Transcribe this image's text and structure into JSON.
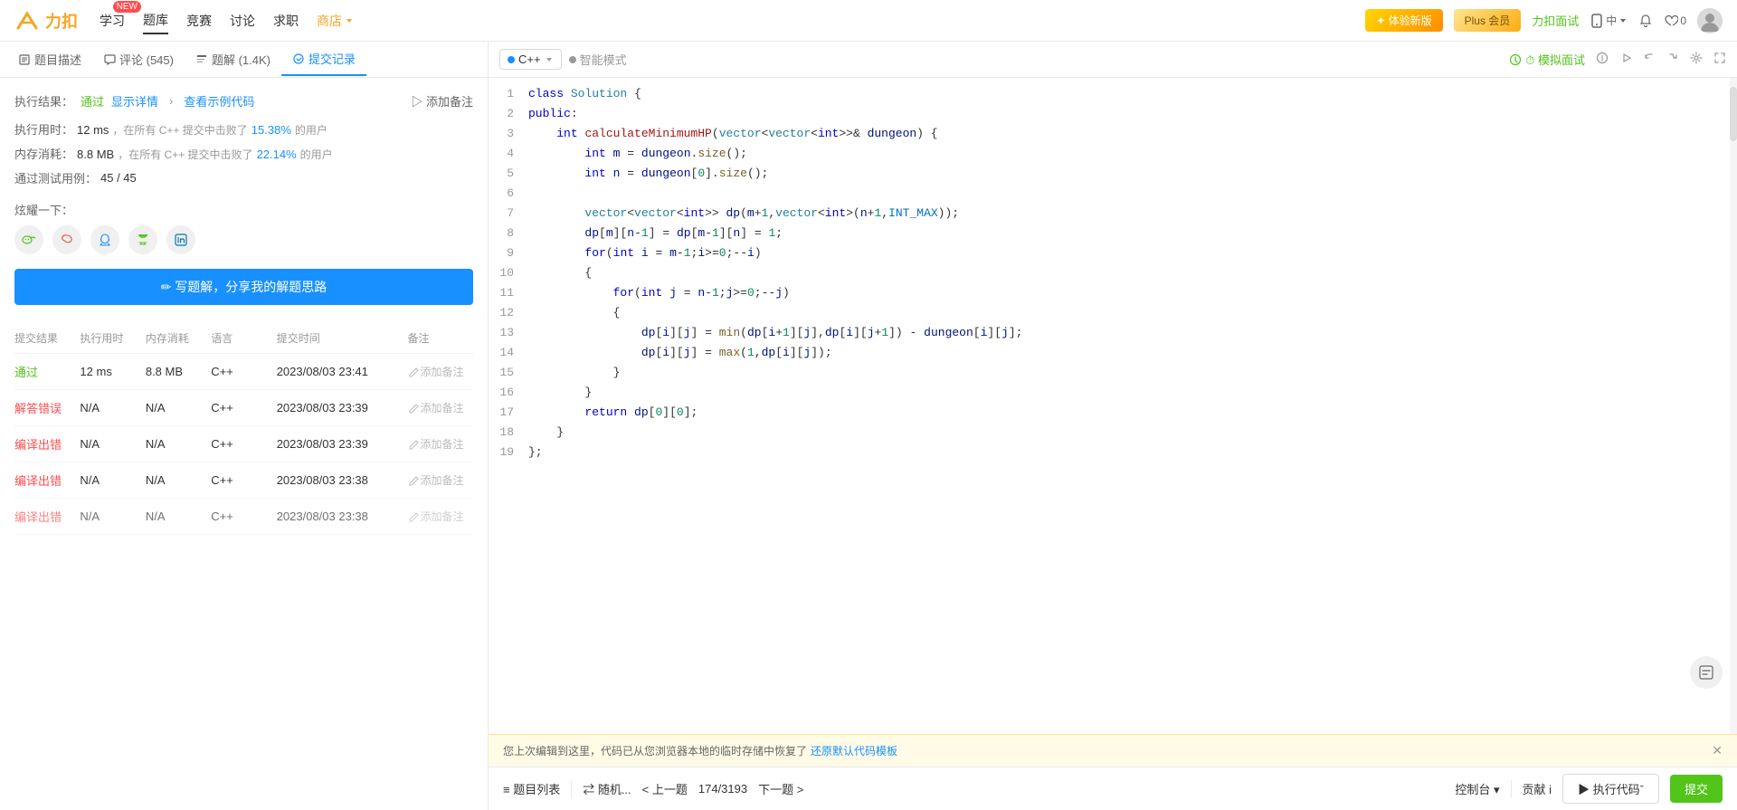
{
  "nav": {
    "logo": "力扣",
    "items": [
      {
        "label": "学习",
        "active": false,
        "badge": "NEW"
      },
      {
        "label": "题库",
        "active": true
      },
      {
        "label": "竞赛",
        "active": false
      },
      {
        "label": "讨论",
        "active": false
      },
      {
        "label": "求职",
        "active": false
      },
      {
        "label": "商店",
        "active": false,
        "shop": true
      }
    ],
    "experience_btn": "✦ 体验新版",
    "plus_btn": "Plus 会员",
    "interview_btn": "力扣面试",
    "phone_icon": "📱",
    "font_size": "中",
    "bell_icon": "🔔",
    "like_count": "0"
  },
  "tabs": [
    {
      "label": "题目描述",
      "icon": "≡"
    },
    {
      "label": "评论 (545)",
      "icon": "💬"
    },
    {
      "label": "题解 (1.4K)",
      "icon": "📄"
    },
    {
      "label": "提交记录",
      "active": true,
      "icon": "📋"
    }
  ],
  "result": {
    "label": "执行结果：",
    "status": "通过",
    "detail_link": "显示详情",
    "example_link": "查看示例代码",
    "add_note": "▷ 添加备注",
    "runtime_label": "执行用时：",
    "runtime_value": "12 ms",
    "runtime_beat_text": "，在所有 C++ 提交中击败了",
    "runtime_percent": "15.38%",
    "runtime_suffix": "的用户",
    "memory_label": "内存消耗：",
    "memory_value": "8.8 MB",
    "memory_beat_text": "，在所有 C++ 提交中击败了",
    "memory_percent": "22.14%",
    "memory_suffix": "的用户",
    "testcase_label": "通过测试用例：",
    "testcase_value": "45 / 45",
    "share_label": "炫耀一下：",
    "write_btn": "✏ 写题解，分享我的解题思路"
  },
  "submissions": {
    "headers": [
      "提交结果",
      "执行用时",
      "内存消耗",
      "语言",
      "提交时间",
      "备注"
    ],
    "rows": [
      {
        "status": "通过",
        "status_type": "pass",
        "time": "12 ms",
        "memory": "8.8 MB",
        "lang": "C++",
        "date": "2023/08/03 23:41",
        "note": "添加备注"
      },
      {
        "status": "解答错误",
        "status_type": "wrong",
        "time": "N/A",
        "memory": "N/A",
        "lang": "C++",
        "date": "2023/08/03 23:39",
        "note": "添加备注"
      },
      {
        "status": "编译出错",
        "status_type": "compile",
        "time": "N/A",
        "memory": "N/A",
        "lang": "C++",
        "date": "2023/08/03 23:39",
        "note": "添加备注"
      },
      {
        "status": "编译出错",
        "status_type": "compile",
        "time": "N/A",
        "memory": "N/A",
        "lang": "C++",
        "date": "2023/08/03 23:38",
        "note": "添加备注"
      },
      {
        "status": "编译出错",
        "status_type": "compile",
        "time": "N/A",
        "memory": "N/A",
        "lang": "C++",
        "date": "2023/08/03 23:38",
        "note": "添加备注"
      }
    ]
  },
  "editor": {
    "lang": "C++",
    "mode": "智能模式",
    "mock_btn": "⏱ 模拟面试",
    "toolbar_icons": [
      "i",
      "▷",
      "↩",
      "→",
      "⚙",
      "⤢"
    ]
  },
  "notification": {
    "text": "您上次编辑到这里，代码已从您浏览器本地的临时存储中恢复了",
    "link": "还原默认代码模板",
    "close": "✕"
  },
  "bottom": {
    "problem_list_btn": "≡ 题目列表",
    "random_btn": "⇄ 随机...",
    "prev_btn": "< 上一题",
    "page_info": "174/3193",
    "next_btn": "下一题 >",
    "console_btn": "控制台 ▾",
    "contribute_btn": "贡献 i",
    "run_btn": "▶ 执行代码ˇ",
    "submit_btn": "提交"
  },
  "code_lines": [
    {
      "num": 1,
      "content": "class Solution {"
    },
    {
      "num": 2,
      "content": "public:"
    },
    {
      "num": 3,
      "content": "    int calculateMinimumHP(vector<vector<int>>& dungeon) {"
    },
    {
      "num": 4,
      "content": "        int m = dungeon.size();"
    },
    {
      "num": 5,
      "content": "        int n = dungeon[0].size();"
    },
    {
      "num": 6,
      "content": ""
    },
    {
      "num": 7,
      "content": "        vector<vector<int>> dp(m+1,vector<int>(n+1,INT_MAX));"
    },
    {
      "num": 8,
      "content": "        dp[m][n-1] = dp[m-1][n] = 1;"
    },
    {
      "num": 9,
      "content": "        for(int i = m-1;i>=0;--i)"
    },
    {
      "num": 10,
      "content": "        {"
    },
    {
      "num": 11,
      "content": "            for(int j = n-1;j>=0;--j)"
    },
    {
      "num": 12,
      "content": "            {"
    },
    {
      "num": 13,
      "content": "                dp[i][j] = min(dp[i+1][j],dp[i][j+1]) - dungeon[i][j];"
    },
    {
      "num": 14,
      "content": "                dp[i][j] = max(1,dp[i][j]);"
    },
    {
      "num": 15,
      "content": "            }"
    },
    {
      "num": 16,
      "content": "        }"
    },
    {
      "num": 17,
      "content": "        return dp[0][0];"
    },
    {
      "num": 18,
      "content": "    }"
    },
    {
      "num": 19,
      "content": "};"
    }
  ]
}
